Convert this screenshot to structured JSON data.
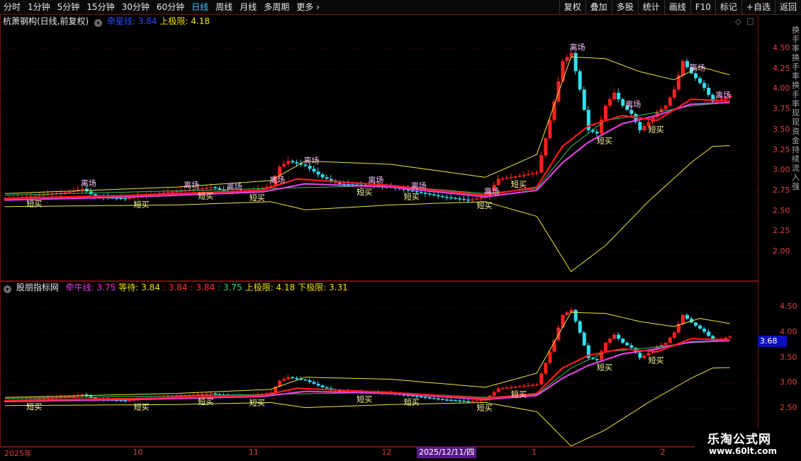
{
  "toolbar": {
    "periods": [
      "分时",
      "1分钟",
      "5分钟",
      "15分钟",
      "30分钟",
      "60分钟",
      "日线",
      "周线",
      "月线",
      "多周期",
      "更多"
    ],
    "active": "日线",
    "more_arrow": "›",
    "buttons": [
      "复权",
      "叠加",
      "多股",
      "统计",
      "画线",
      "F10",
      "标记",
      "+自选",
      "返回"
    ]
  },
  "main_panel": {
    "title": "杭萧钢构(日线,前复权)",
    "legend": [
      {
        "label": "牵星线:",
        "value": "3.84",
        "color": "#2a4bff"
      },
      {
        "label": "上极限:",
        "value": "4.18",
        "color": "#f0e000"
      }
    ],
    "ticks": [
      "4.50",
      "4.25",
      "4.00",
      "3.75",
      "3.50",
      "3.25",
      "3.00",
      "2.75",
      "2.50",
      "2.25",
      "2.00"
    ],
    "tick_values": [
      4.5,
      4.25,
      4.0,
      3.75,
      3.5,
      3.25,
      3.0,
      2.75,
      2.5,
      2.25,
      2.0
    ],
    "side_text": "换手率换手率换手率现现资金持续流入强"
  },
  "ind_panel": {
    "title": "股朋指标网",
    "legend": [
      {
        "label": "牵牛线:",
        "value": "3.75",
        "color": "#e040e0"
      },
      {
        "label": "等待:",
        "value": "3.84",
        "color": "#f0e000"
      },
      {
        "label": ":",
        "value": "3.84",
        "color": "#ff3030"
      },
      {
        "label": ":",
        "value": "3.84",
        "color": "#ff3030"
      },
      {
        "label": ":",
        "value": "3.75",
        "color": "#30d080"
      },
      {
        "label": "上极限:",
        "value": "4.18",
        "color": "#f0e000"
      },
      {
        "label": "下极限:",
        "value": "3.31",
        "color": "#f0e000"
      }
    ],
    "ticks": [
      "4.50",
      "4.00",
      "3.50",
      "3.00",
      "2.50"
    ],
    "tick_values": [
      4.5,
      4.0,
      3.5,
      3.0,
      2.5
    ],
    "price_tag": "3.68"
  },
  "xaxis": {
    "labels": [
      {
        "text": "2025年",
        "bar": 0
      },
      {
        "text": "10",
        "bar": 30
      },
      {
        "text": "11",
        "bar": 57
      },
      {
        "text": "12",
        "bar": 88
      },
      {
        "text": "1",
        "bar": 123
      },
      {
        "text": "2",
        "bar": 153
      }
    ],
    "cursor": "2025/12/11/四"
  },
  "signals": {
    "leave": "离场",
    "short_buy": "短买"
  },
  "logo": {
    "name": "乐淘公式网",
    "url": "www.60lt.com"
  },
  "colors": {
    "up": "#ff2020",
    "down": "#30e0f0",
    "ma1": "#ff1a1a",
    "ma2": "#e040e0",
    "band": "#e8e840",
    "mid": "#30c060"
  },
  "chart_data": {
    "type": "candlestick",
    "bars": 170,
    "closes_keypoints": [
      [
        0,
        2.66
      ],
      [
        8,
        2.7
      ],
      [
        15,
        2.74
      ],
      [
        18,
        2.78
      ],
      [
        21,
        2.68
      ],
      [
        28,
        2.66
      ],
      [
        35,
        2.72
      ],
      [
        42,
        2.76
      ],
      [
        48,
        2.8
      ],
      [
        52,
        2.74
      ],
      [
        58,
        2.76
      ],
      [
        62,
        2.82
      ],
      [
        64,
        3.05
      ],
      [
        66,
        3.12
      ],
      [
        70,
        3.06
      ],
      [
        74,
        2.92
      ],
      [
        78,
        2.84
      ],
      [
        85,
        2.82
      ],
      [
        90,
        2.8
      ],
      [
        96,
        2.74
      ],
      [
        102,
        2.68
      ],
      [
        108,
        2.64
      ],
      [
        112,
        2.68
      ],
      [
        115,
        2.9
      ],
      [
        120,
        2.94
      ],
      [
        124,
        2.98
      ],
      [
        126,
        3.4
      ],
      [
        128,
        3.85
      ],
      [
        130,
        4.35
      ],
      [
        132,
        4.45
      ],
      [
        134,
        4.0
      ],
      [
        136,
        3.5
      ],
      [
        138,
        3.46
      ],
      [
        140,
        3.8
      ],
      [
        142,
        3.96
      ],
      [
        144,
        3.8
      ],
      [
        146,
        3.7
      ],
      [
        148,
        3.5
      ],
      [
        150,
        3.6
      ],
      [
        152,
        3.72
      ],
      [
        154,
        3.8
      ],
      [
        156,
        4.0
      ],
      [
        158,
        4.35
      ],
      [
        160,
        4.2
      ],
      [
        163,
        4.02
      ],
      [
        165,
        3.85
      ],
      [
        167,
        3.88
      ],
      [
        169,
        3.92
      ]
    ],
    "ma_long_keypoints": [
      [
        0,
        2.64
      ],
      [
        30,
        2.68
      ],
      [
        60,
        2.74
      ],
      [
        70,
        2.84
      ],
      [
        90,
        2.8
      ],
      [
        112,
        2.68
      ],
      [
        124,
        2.76
      ],
      [
        130,
        3.1
      ],
      [
        136,
        3.35
      ],
      [
        144,
        3.58
      ],
      [
        152,
        3.68
      ],
      [
        160,
        3.82
      ],
      [
        169,
        3.84
      ]
    ],
    "ma_short_keypoints": [
      [
        0,
        2.66
      ],
      [
        30,
        2.7
      ],
      [
        60,
        2.76
      ],
      [
        68,
        2.9
      ],
      [
        90,
        2.82
      ],
      [
        112,
        2.7
      ],
      [
        124,
        2.8
      ],
      [
        130,
        3.3
      ],
      [
        136,
        3.55
      ],
      [
        144,
        3.68
      ],
      [
        152,
        3.62
      ],
      [
        160,
        3.88
      ],
      [
        169,
        3.86
      ]
    ],
    "upper_band_keypoints": [
      [
        0,
        2.72
      ],
      [
        40,
        2.8
      ],
      [
        62,
        2.88
      ],
      [
        70,
        3.12
      ],
      [
        90,
        3.08
      ],
      [
        112,
        2.92
      ],
      [
        124,
        3.2
      ],
      [
        132,
        4.4
      ],
      [
        140,
        4.38
      ],
      [
        148,
        4.22
      ],
      [
        156,
        4.12
      ],
      [
        162,
        4.28
      ],
      [
        169,
        4.18
      ]
    ],
    "lower_band_keypoints": [
      [
        0,
        2.56
      ],
      [
        40,
        2.58
      ],
      [
        62,
        2.62
      ],
      [
        70,
        2.52
      ],
      [
        90,
        2.58
      ],
      [
        112,
        2.62
      ],
      [
        124,
        2.44
      ],
      [
        128,
        2.1
      ],
      [
        132,
        1.76
      ],
      [
        140,
        2.08
      ],
      [
        150,
        2.62
      ],
      [
        160,
        3.1
      ],
      [
        165,
        3.3
      ],
      [
        169,
        3.31
      ]
    ],
    "mid_band_keypoints": [
      [
        0,
        2.7
      ],
      [
        60,
        2.78
      ],
      [
        90,
        2.82
      ],
      [
        112,
        2.72
      ],
      [
        124,
        2.78
      ],
      [
        132,
        3.3
      ],
      [
        140,
        3.62
      ],
      [
        150,
        3.7
      ],
      [
        160,
        3.8
      ],
      [
        169,
        3.84
      ]
    ],
    "leave_signals": [
      18,
      42,
      52,
      62,
      70,
      85,
      95,
      112,
      132,
      145,
      160,
      166
    ],
    "short_buy_signals": [
      5,
      30,
      45,
      57,
      82,
      93,
      110,
      118,
      138,
      150
    ]
  }
}
